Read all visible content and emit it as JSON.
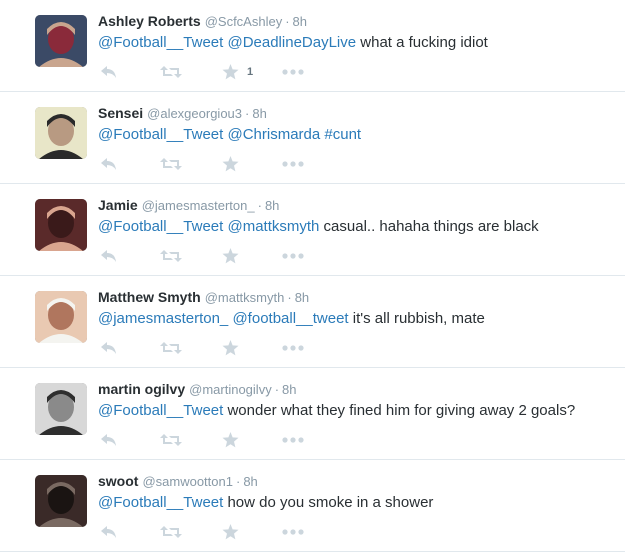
{
  "tweets": [
    {
      "name": "Ashley Roberts",
      "handle": "@ScfcAshley",
      "time": "8h",
      "segments": [
        {
          "t": "@Football__Tweet",
          "k": "mention"
        },
        {
          "t": " ",
          "k": "text"
        },
        {
          "t": "@DeadlineDayLive",
          "k": "mention"
        },
        {
          "t": " what a fucking idiot",
          "k": "text"
        }
      ],
      "favorite_count": "1",
      "avatar_colors": [
        "#3b4a66",
        "#c9a58e",
        "#8a2a3a"
      ]
    },
    {
      "name": "Sensei",
      "handle": "@alexgeorgiou3",
      "time": "8h",
      "segments": [
        {
          "t": "@Football__Tweet",
          "k": "mention"
        },
        {
          "t": " ",
          "k": "text"
        },
        {
          "t": "@Chrismarda",
          "k": "mention"
        },
        {
          "t": " ",
          "k": "text"
        },
        {
          "t": "#cunt",
          "k": "hashtag"
        }
      ],
      "favorite_count": "",
      "avatar_colors": [
        "#e8e6c8",
        "#2a2a2a",
        "#b89a82"
      ]
    },
    {
      "name": "Jamie",
      "handle": "@jamesmasterton_",
      "time": "8h",
      "segments": [
        {
          "t": "@Football__Tweet",
          "k": "mention"
        },
        {
          "t": " ",
          "k": "text"
        },
        {
          "t": "@mattksmyth",
          "k": "mention"
        },
        {
          "t": " casual.. hahaha things are black",
          "k": "text"
        }
      ],
      "favorite_count": "",
      "avatar_colors": [
        "#5a2a2a",
        "#d9a58f",
        "#3a1a1a"
      ]
    },
    {
      "name": "Matthew Smyth",
      "handle": "@mattksmyth",
      "time": "8h",
      "segments": [
        {
          "t": "@jamesmasterton_",
          "k": "mention"
        },
        {
          "t": " ",
          "k": "text"
        },
        {
          "t": "@football__tweet",
          "k": "mention"
        },
        {
          "t": " it's all rubbish, mate",
          "k": "text"
        }
      ],
      "favorite_count": "",
      "avatar_colors": [
        "#e9c9b2",
        "#f4f4f0",
        "#b0765e"
      ]
    },
    {
      "name": "martin ogilvy",
      "handle": "@martinogilvy",
      "time": "8h",
      "segments": [
        {
          "t": "@Football__Tweet",
          "k": "mention"
        },
        {
          "t": " wonder what they fined him for giving away 2 goals?",
          "k": "text"
        }
      ],
      "favorite_count": "",
      "avatar_colors": [
        "#d8d8d8",
        "#2e2e2e",
        "#8a8a8a"
      ]
    },
    {
      "name": "swoot",
      "handle": "@samwootton1",
      "time": "8h",
      "segments": [
        {
          "t": "@Football__Tweet",
          "k": "mention"
        },
        {
          "t": " how do you smoke in a shower",
          "k": "text"
        }
      ],
      "favorite_count": "",
      "avatar_colors": [
        "#3a2a28",
        "#7a6a62",
        "#1a1412"
      ]
    }
  ],
  "icons": {
    "reply": "reply-icon",
    "retweet": "retweet-icon",
    "favorite": "star-icon",
    "more": "more-icon"
  },
  "colors": {
    "link": "#2b7bb9",
    "meta": "#8899a6",
    "action": "#ccd6dd",
    "divider": "#e1e8ed"
  }
}
